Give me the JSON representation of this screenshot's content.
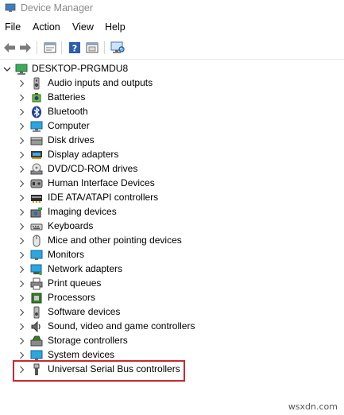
{
  "window": {
    "title": "Device Manager"
  },
  "menu": {
    "file": "File",
    "action": "Action",
    "view": "View",
    "help": "Help"
  },
  "toolbar": {
    "buttons": [
      "back-icon",
      "forward-icon",
      "properties-icon",
      "help-icon",
      "show-hidden-icon",
      "scan-hardware-icon"
    ]
  },
  "tree": {
    "root": "DESKTOP-PRGMDU8",
    "categories": [
      {
        "label": "Audio inputs and outputs",
        "icon": "speaker-icon"
      },
      {
        "label": "Batteries",
        "icon": "battery-icon"
      },
      {
        "label": "Bluetooth",
        "icon": "bluetooth-icon"
      },
      {
        "label": "Computer",
        "icon": "computer-icon"
      },
      {
        "label": "Disk drives",
        "icon": "disk-drive-icon"
      },
      {
        "label": "Display adapters",
        "icon": "display-adapter-icon"
      },
      {
        "label": "DVD/CD-ROM drives",
        "icon": "dvd-icon"
      },
      {
        "label": "Human Interface Devices",
        "icon": "hid-icon"
      },
      {
        "label": "IDE ATA/ATAPI controllers",
        "icon": "ide-controller-icon"
      },
      {
        "label": "Imaging devices",
        "icon": "camera-icon"
      },
      {
        "label": "Keyboards",
        "icon": "keyboard-icon"
      },
      {
        "label": "Mice and other pointing devices",
        "icon": "mouse-icon"
      },
      {
        "label": "Monitors",
        "icon": "monitor-icon"
      },
      {
        "label": "Network adapters",
        "icon": "network-adapter-icon"
      },
      {
        "label": "Print queues",
        "icon": "printer-icon"
      },
      {
        "label": "Processors",
        "icon": "processor-icon"
      },
      {
        "label": "Software devices",
        "icon": "software-device-icon"
      },
      {
        "label": "Sound, video and game controllers",
        "icon": "sound-controller-icon"
      },
      {
        "label": "Storage controllers",
        "icon": "storage-controller-icon"
      },
      {
        "label": "System devices",
        "icon": "system-device-icon"
      },
      {
        "label": "Universal Serial Bus controllers",
        "icon": "usb-icon"
      }
    ]
  },
  "highlight": {
    "target": "Universal Serial Bus controllers",
    "color": "#c8292e"
  },
  "watermark": "wsxdn.com"
}
